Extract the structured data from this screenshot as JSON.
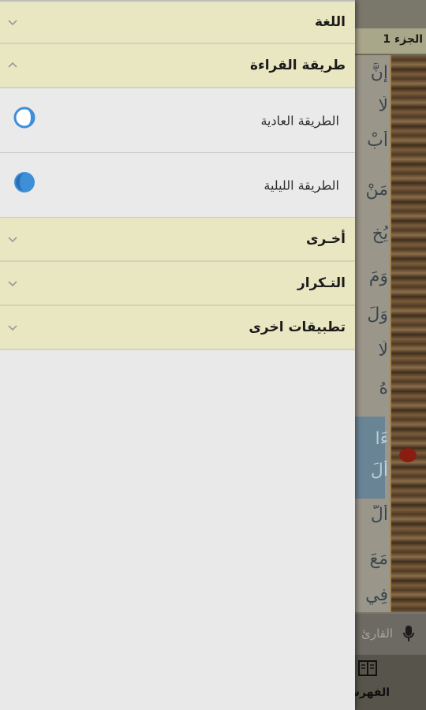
{
  "background_app": {
    "juz_label": "الجزء 1",
    "verse_fragments": [
      "إِنَّ",
      "لَا",
      "أَبْ",
      "مَنْ",
      "يُخ",
      "وَمَ",
      "وَلَ",
      "لَا",
      "هُ",
      "ءَا",
      "أَلَ",
      "أَلَّ",
      "مَعَ",
      "فِي"
    ],
    "search_placeholder": "القارئ",
    "index_label": "الفهرس",
    "mic_icon": "microphone-icon",
    "index_icon": "book-icon"
  },
  "drawer": {
    "sections": {
      "language": {
        "title": "اللغة",
        "expanded": false
      },
      "reading_mode": {
        "title": "طريقة القراءة",
        "expanded": true,
        "options": [
          {
            "label": "الطريقة العادية",
            "icon": "day-mode-icon"
          },
          {
            "label": "الطريقة الليلية",
            "icon": "night-mode-icon"
          }
        ]
      },
      "other": {
        "title": "أخـرى",
        "expanded": false
      },
      "repetition": {
        "title": "التـكرار",
        "expanded": false
      },
      "other_apps": {
        "title": "تطبيقات اخرى",
        "expanded": false
      }
    }
  },
  "colors": {
    "section_bg": "#e9e6c2",
    "accent_blue": "#3d8fd8"
  }
}
